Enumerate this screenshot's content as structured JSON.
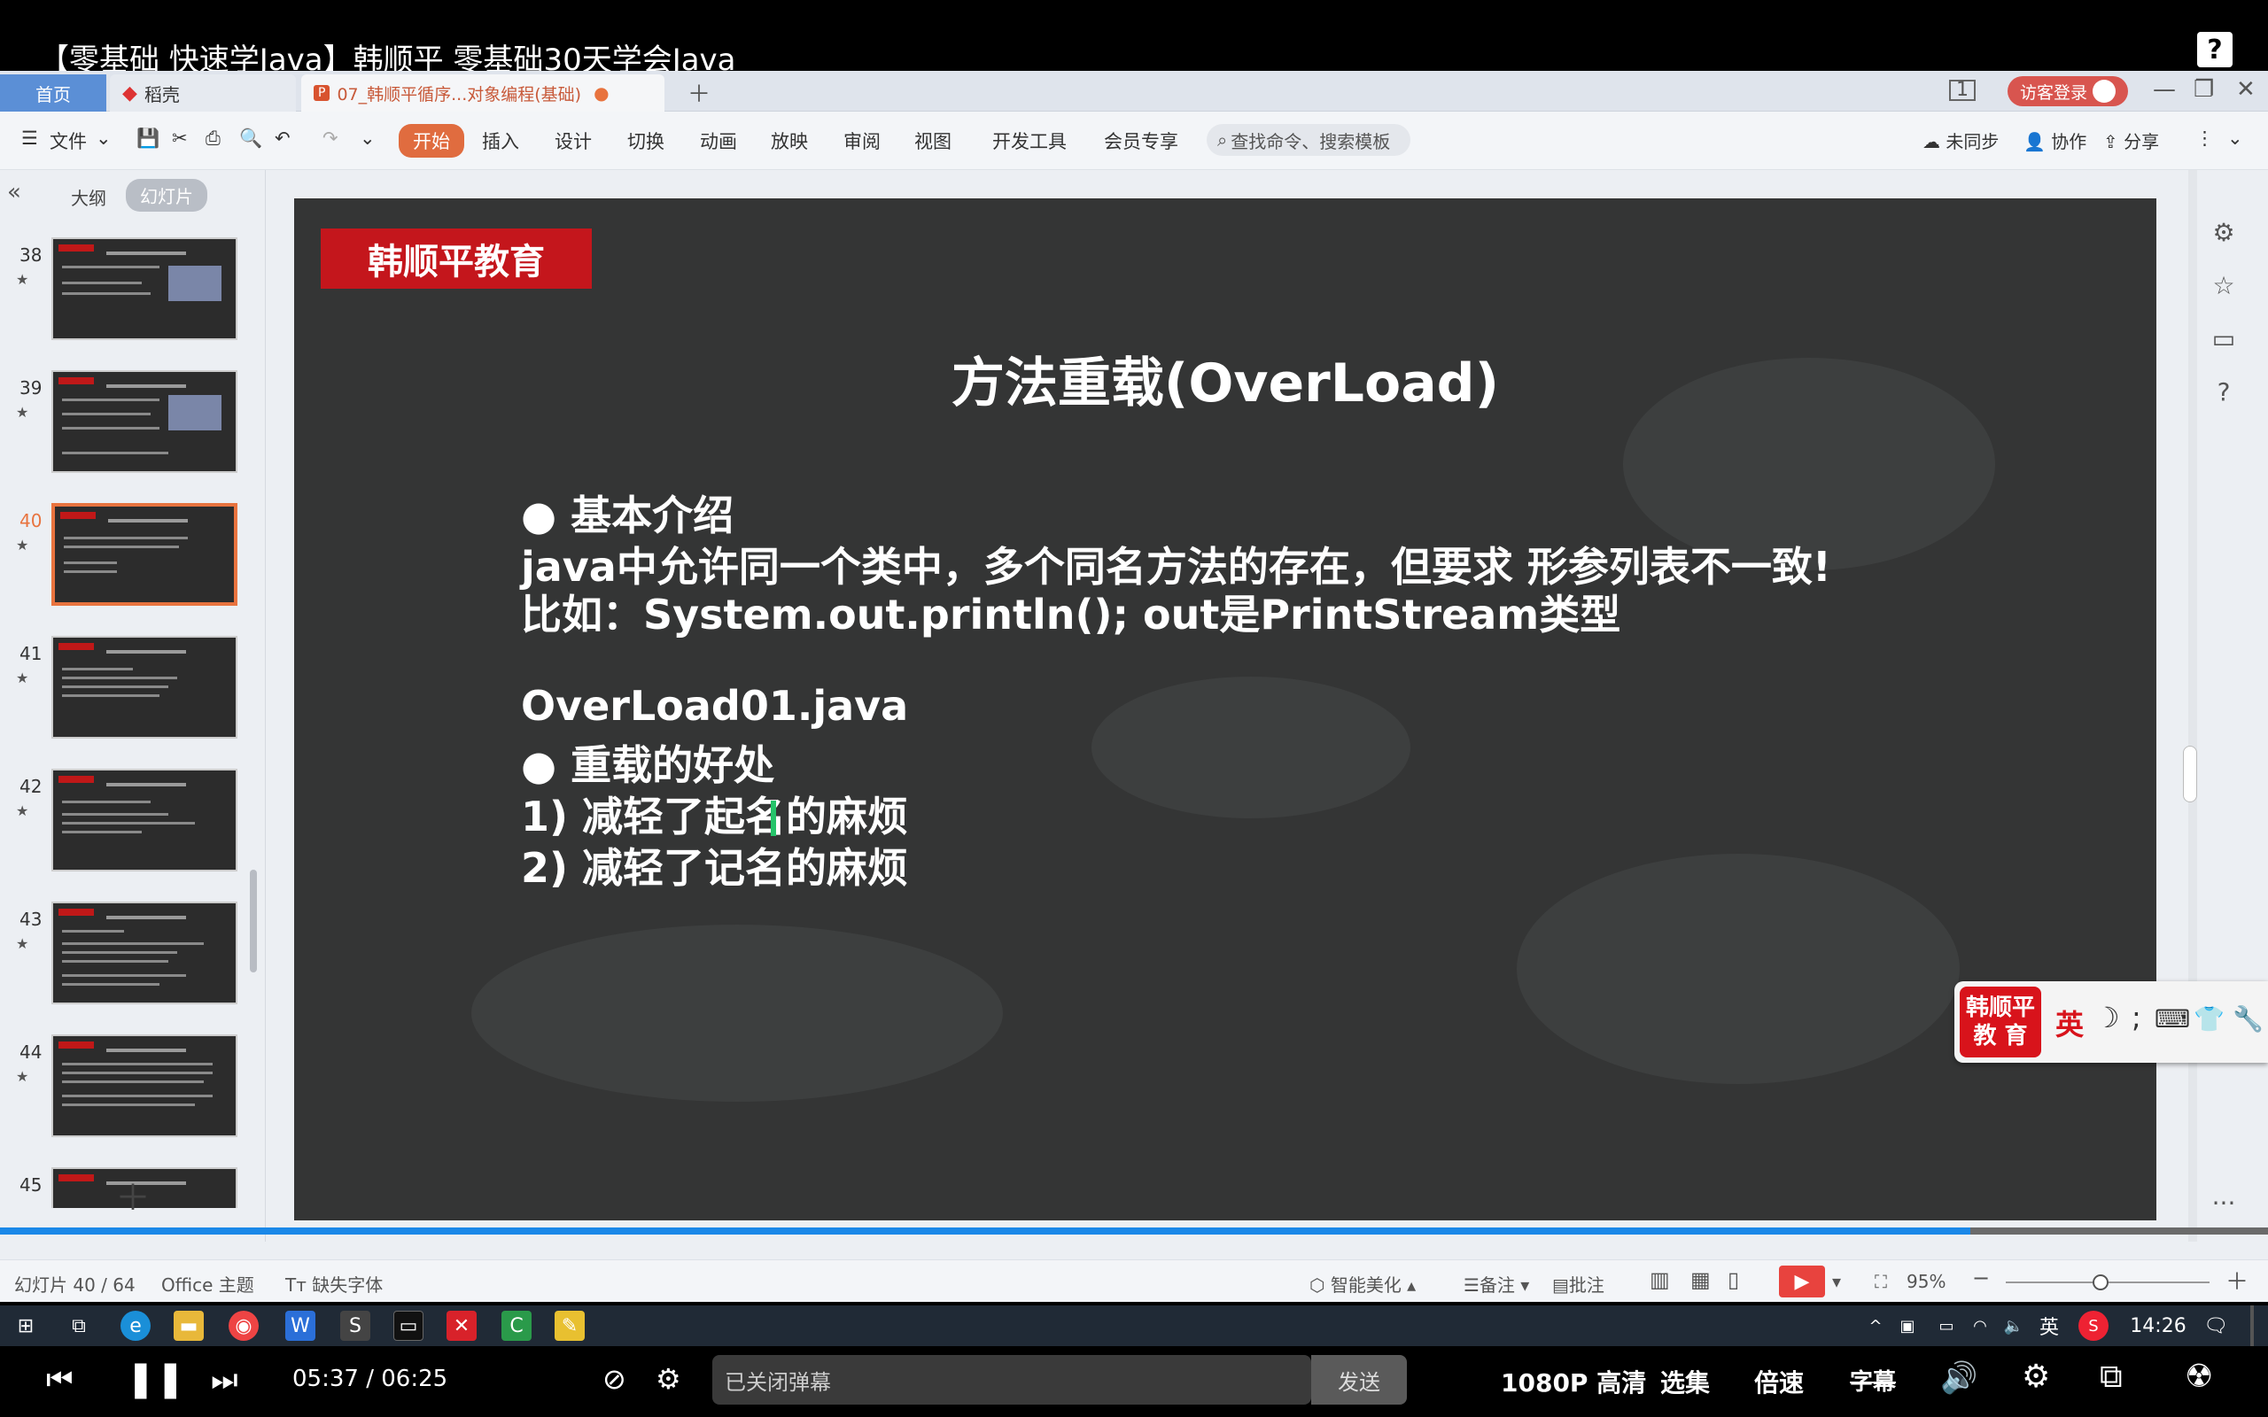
{
  "video": {
    "title": "【零基础 快速学Java】韩顺平 零基础30天学会Java",
    "help": "?"
  },
  "wps": {
    "tabs": {
      "home": "首页",
      "daoke": "稻壳",
      "doc": "07_韩顺平循序...对象编程(基础)",
      "login": "访客登录"
    },
    "ribbon": {
      "file": "文件",
      "start": "开始",
      "insert": "插入",
      "design": "设计",
      "switch": "切换",
      "animation": "动画",
      "slideshow": "放映",
      "review": "审阅",
      "view": "视图",
      "devtools": "开发工具",
      "member": "会员专享",
      "search_placeholder": "查找命令、搜索模板",
      "unsync": "未同步",
      "collab": "协作",
      "share": "分享"
    },
    "panel_tabs": {
      "outline": "大纲",
      "slides": "幻灯片"
    },
    "thumbnails": [
      {
        "num": "38",
        "selected": false
      },
      {
        "num": "39",
        "selected": false
      },
      {
        "num": "40",
        "selected": true
      },
      {
        "num": "41",
        "selected": false
      },
      {
        "num": "42",
        "selected": false
      },
      {
        "num": "43",
        "selected": false
      },
      {
        "num": "44",
        "selected": false
      },
      {
        "num": "45",
        "selected": false
      }
    ],
    "status": {
      "slide_count": "幻灯片 40 / 64",
      "theme": "Office 主题",
      "missing_font": "缺失字体",
      "beautify": "智能美化",
      "notes": "备注",
      "comment": "批注",
      "zoom": "95%"
    }
  },
  "slide": {
    "brand": "韩顺平教育",
    "title": "方法重载(OverLoad)",
    "lines": [
      "●  基本介绍",
      "java中允许同一个类中，多个同名方法的存在，但要求 形参列表不一致!",
      "比如：System.out.println();   out是PrintStream类型",
      "OverLoad01.java",
      "●  重载的好处",
      "1) 减轻了起名的麻烦",
      "2) 减轻了记名的麻烦"
    ]
  },
  "ime": {
    "logo_line1": "韩顺平",
    "logo_line2": "教 育",
    "lang": "英"
  },
  "taskbar": {
    "lang": "英",
    "time": "14:26"
  },
  "player": {
    "current": "05:37",
    "sep": "/",
    "total": "06:25",
    "danmu_placeholder": "已关闭弹幕",
    "send": "发送",
    "quality": "1080P 高清",
    "episodes": "选集",
    "speed": "倍速",
    "subtitle": "字幕"
  }
}
